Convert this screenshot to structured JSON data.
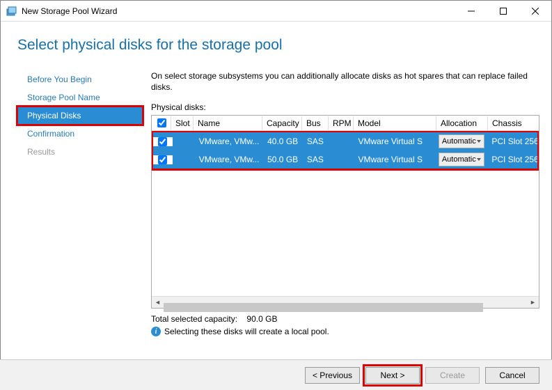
{
  "window": {
    "title": "New Storage Pool Wizard"
  },
  "page_title": "Select physical disks for the storage pool",
  "intro": "On select storage subsystems you can additionally allocate disks as hot spares that can replace failed disks.",
  "physical_disks_label": "Physical disks:",
  "sidebar": {
    "items": [
      {
        "label": "Before You Begin",
        "state": "normal"
      },
      {
        "label": "Storage Pool Name",
        "state": "normal"
      },
      {
        "label": "Physical Disks",
        "state": "selected"
      },
      {
        "label": "Confirmation",
        "state": "normal"
      },
      {
        "label": "Results",
        "state": "disabled"
      }
    ]
  },
  "table": {
    "headers": {
      "slot": "Slot",
      "name": "Name",
      "capacity": "Capacity",
      "bus": "Bus",
      "rpm": "RPM",
      "model": "Model",
      "allocation": "Allocation",
      "chassis": "Chassis"
    },
    "rows": [
      {
        "checked": true,
        "slot": "",
        "name": "VMware, VMw...",
        "capacity": "40.0 GB",
        "bus": "SAS",
        "rpm": "",
        "model": "VMware Virtual S",
        "allocation": "Automatic",
        "chassis": "PCI Slot 256"
      },
      {
        "checked": true,
        "slot": "",
        "name": "VMware, VMw...",
        "capacity": "50.0 GB",
        "bus": "SAS",
        "rpm": "",
        "model": "VMware Virtual S",
        "allocation": "Automatic",
        "chassis": "PCI Slot 256"
      }
    ]
  },
  "summary": {
    "capacity_label": "Total selected capacity:",
    "capacity_value": "90.0 GB",
    "info": "Selecting these disks will create a local pool."
  },
  "footer": {
    "previous": "< Previous",
    "next": "Next >",
    "create": "Create",
    "cancel": "Cancel"
  }
}
